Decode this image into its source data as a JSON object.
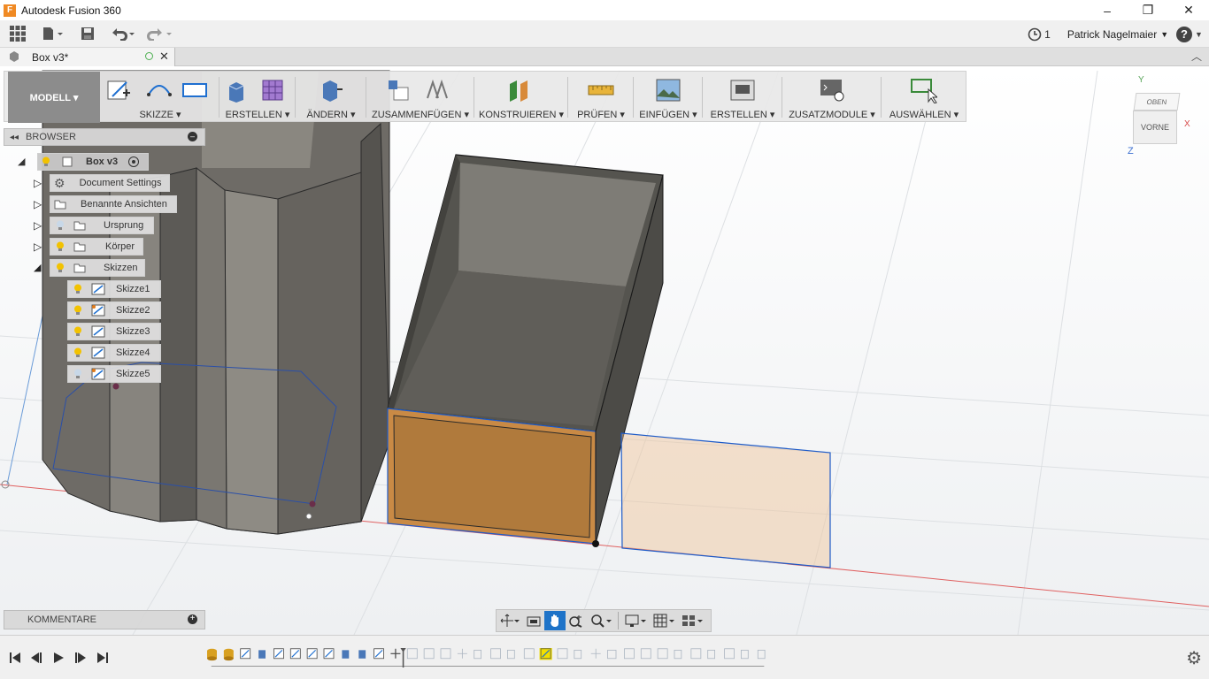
{
  "window": {
    "title": "Autodesk Fusion 360",
    "logo_letter": "F",
    "controls": [
      "–",
      "❐",
      "✕"
    ]
  },
  "qat": {
    "job_count": "1",
    "user": "Patrick Nagelmaier",
    "help": "?"
  },
  "tab": {
    "name": "Box v3*"
  },
  "toolbar": {
    "workspace": "MODELL ▾",
    "groups": [
      {
        "label": "SKIZZE ▾"
      },
      {
        "label": "ERSTELLEN ▾"
      },
      {
        "label": "ÄNDERN ▾"
      },
      {
        "label": "ZUSAMMENFÜGEN ▾"
      },
      {
        "label": "KONSTRUIEREN ▾"
      },
      {
        "label": "PRÜFEN ▾"
      },
      {
        "label": "EINFÜGEN ▾"
      },
      {
        "label": "ERSTELLEN ▾"
      },
      {
        "label": "ZUSATZMODULE ▾"
      },
      {
        "label": "AUSWÄHLEN ▾"
      }
    ]
  },
  "browser": {
    "title": "BROWSER",
    "root": "Box v3",
    "items": [
      {
        "label": "Document Settings"
      },
      {
        "label": "Benannte Ansichten"
      },
      {
        "label": "Ursprung"
      },
      {
        "label": "Körper"
      },
      {
        "label": "Skizzen"
      }
    ],
    "sketches": [
      "Skizze1",
      "Skizze2",
      "Skizze3",
      "Skizze4",
      "Skizze5"
    ]
  },
  "viewcube": {
    "top": "OBEN",
    "front": "VORNE",
    "axis_x": "X",
    "axis_y": "Y",
    "axis_z": "Z"
  },
  "comments": {
    "title": "KOMMENTARE"
  },
  "colors": {
    "accent": "#1e73c8",
    "highlight": "#f2c200",
    "body": "#7d7a74",
    "face": "#c98a45"
  }
}
